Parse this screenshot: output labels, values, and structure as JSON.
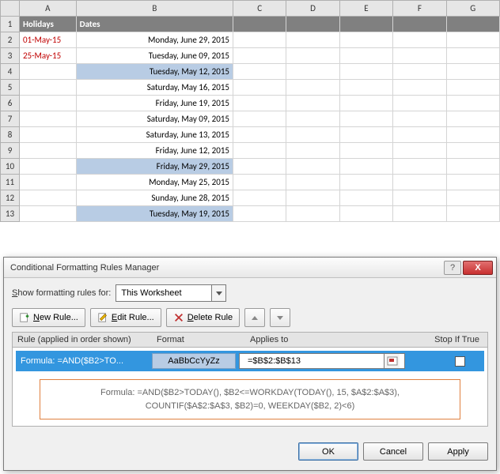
{
  "columns": [
    "A",
    "B",
    "C",
    "D",
    "E",
    "F",
    "G"
  ],
  "headers": {
    "A": "Holidays",
    "B": "Dates"
  },
  "rows": [
    {
      "n": "1"
    },
    {
      "n": "2",
      "A": "01-May-15",
      "B": "Monday, June 29, 2015",
      "holiday": true
    },
    {
      "n": "3",
      "A": "25-May-15",
      "B": "Tuesday, June 09, 2015",
      "holiday": true
    },
    {
      "n": "4",
      "B": "Tuesday, May 12, 2015",
      "hl": true
    },
    {
      "n": "5",
      "B": "Saturday, May 16, 2015"
    },
    {
      "n": "6",
      "B": "Friday, June 19, 2015"
    },
    {
      "n": "7",
      "B": "Saturday, May 09, 2015"
    },
    {
      "n": "8",
      "B": "Saturday, June 13, 2015"
    },
    {
      "n": "9",
      "B": "Friday, June 12, 2015"
    },
    {
      "n": "10",
      "B": "Friday, May 29, 2015",
      "hl": true
    },
    {
      "n": "11",
      "B": "Monday, May 25, 2015"
    },
    {
      "n": "12",
      "B": "Sunday, June 28, 2015"
    },
    {
      "n": "13",
      "B": "Tuesday, May 19, 2015",
      "hl": true
    }
  ],
  "dialog": {
    "title": "Conditional Formatting Rules Manager",
    "show_label_pre": "S",
    "show_label_post": "how formatting rules for:",
    "scope": "This Worksheet",
    "buttons": {
      "new_pre": "",
      "new_u": "N",
      "new_post": "ew Rule...",
      "edit_pre": "",
      "edit_u": "E",
      "edit_post": "dit Rule...",
      "del_pre": "",
      "del_u": "D",
      "del_post": "elete Rule"
    },
    "cols": {
      "rule": "Rule (applied in order shown)",
      "format": "Format",
      "applies": "Applies to",
      "stop": "Stop If True"
    },
    "rule": {
      "label": "Formula: =AND($B2>TO...",
      "preview": "AaBbCcYyZz",
      "applies": "=$B$2:$B$13"
    },
    "formula_line1": "Formula: =AND($B2>TODAY(), $B2<=WORKDAY(TODAY(), 15, $A$2:$A$3),",
    "formula_line2": "COUNTIF($A$2:$A$3, $B2)=0, WEEKDAY($B2, 2)<6)",
    "ok": "OK",
    "cancel": "Cancel",
    "apply": "Apply",
    "help": "?",
    "close": "X"
  }
}
